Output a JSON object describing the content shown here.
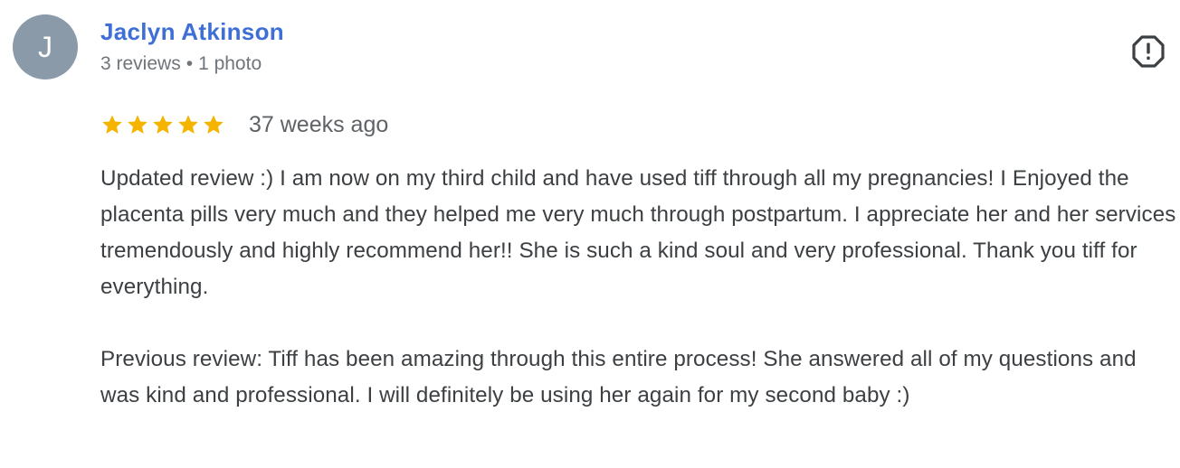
{
  "reviewer": {
    "initial": "J",
    "name": "Jaclyn Atkinson",
    "reviews_count": "3 reviews",
    "separator": "•",
    "photos_count": "1 photo",
    "avatar_color": "#8a9aa8"
  },
  "rating": {
    "stars": 5,
    "max_stars": 5,
    "star_color": "#f4b400",
    "time_ago": "37 weeks ago"
  },
  "review": {
    "paragraphs": [
      "Updated review :) I am now on my third child and have used tiff through all my pregnancies! I Enjoyed the placenta pills very much and they helped me very much through postpartum. I appreciate her and her services tremendously and highly recommend her!! She is such a kind soul and very professional. Thank you tiff for everything.",
      "Previous review: Tiff has been amazing through this entire process! She answered all of my questions and was kind and professional. I will definitely be using her again for my second baby :)"
    ]
  },
  "actions": {
    "report_icon": "report-flag-icon"
  }
}
